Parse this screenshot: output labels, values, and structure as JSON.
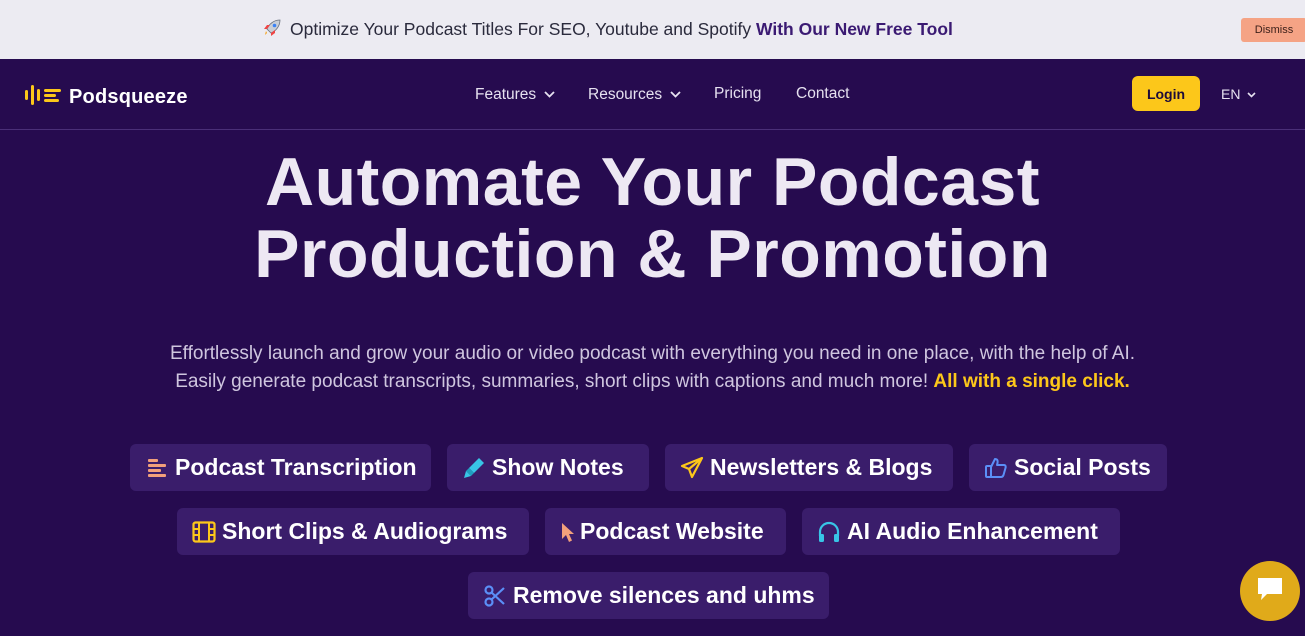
{
  "announcement": {
    "text": "Optimize Your Podcast Titles For SEO, Youtube and Spotify",
    "highlight": "With Our New Free Tool",
    "dismiss_label": "Dismiss"
  },
  "nav": {
    "brand": "Podsqueeze",
    "links": [
      "Features",
      "Resources",
      "Pricing",
      "Contact"
    ],
    "login_label": "Login",
    "language": "EN"
  },
  "hero": {
    "title_line1": "Automate Your Podcast",
    "title_line2": "Production & Promotion",
    "subtitle_line1": "Effortlessly launch and grow your audio or video podcast with everything you need in one place, with the help of AI.",
    "subtitle_line2": "Easily generate podcast transcripts, summaries, short clips with captions and much more!",
    "subtitle_highlight": "All with a single click."
  },
  "features": [
    "Podcast Transcription",
    "Show Notes",
    "Newsletters & Blogs",
    "Social Posts",
    "Short Clips & Audiograms",
    "Podcast Website",
    "AI Audio Enhancement",
    "Remove silences and uhms"
  ],
  "colors": {
    "background": "#260b4f",
    "accent_yellow": "#fcc71a",
    "chip_bg": "#3a1d6b",
    "announce_bg": "#ecebf2",
    "dismiss_bg": "#f5a385"
  },
  "icons": {
    "announcement": "rocket-icon",
    "features": [
      "lines-icon",
      "highlighter-icon",
      "paper-plane-icon",
      "thumbs-up-icon",
      "film-icon",
      "cursor-icon",
      "headphones-icon",
      "scissors-icon"
    ],
    "chat": "chat-bubble-icon"
  }
}
